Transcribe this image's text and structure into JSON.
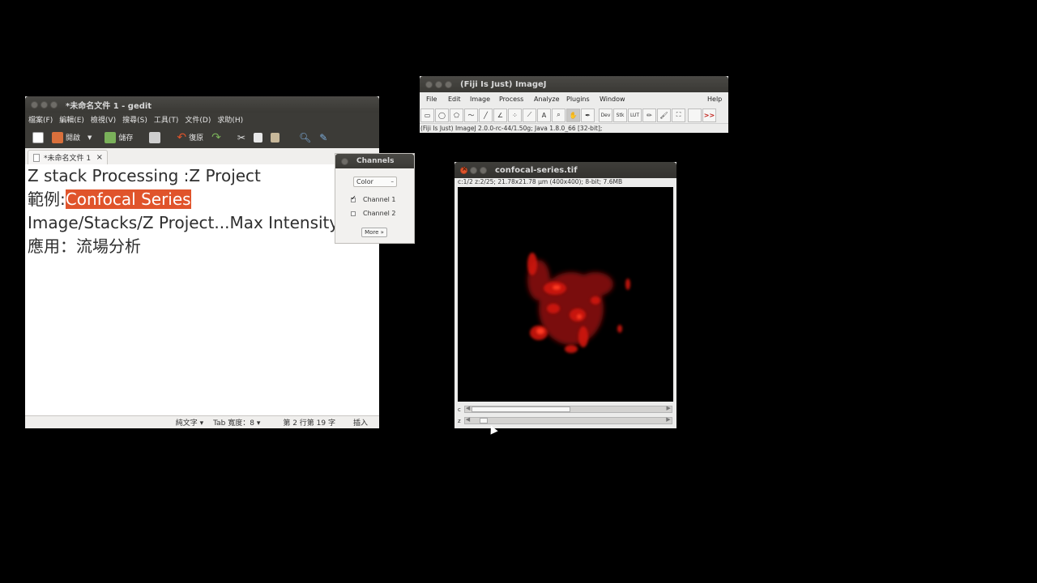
{
  "gedit": {
    "title": "*未命名文件 1 - gedit",
    "menu": [
      "檔案(F)",
      "編輯(E)",
      "檢視(V)",
      "搜尋(S)",
      "工具(T)",
      "文件(D)",
      "求助(H)"
    ],
    "toolbar": {
      "open": "開啟",
      "save": "儲存",
      "undo": "復原"
    },
    "tab_label": "*未命名文件 1",
    "tab_close": "×",
    "lines": {
      "l1": "Z stack Processing :Z Project",
      "l2_prefix": "範例:",
      "l2_selected": "Confocal Series",
      "l3": "Image/Stacks/Z Project...Max Intensity",
      "l4": "應用：流場分析"
    },
    "status": {
      "lang": "純文字 ▾",
      "tab_width": "Tab 寬度：8 ▾",
      "position": "第 2 行第 19 字",
      "mode": "插入"
    }
  },
  "channels": {
    "title": "Channels",
    "mode": "Color",
    "channel1": "Channel 1",
    "channel1_checked": true,
    "channel2": "Channel 2",
    "channel2_checked": false,
    "more": "More »"
  },
  "imagej": {
    "title": "(Fiji Is Just) ImageJ",
    "menu": [
      "File",
      "Edit",
      "Image",
      "Process",
      "Analyze",
      "Plugins",
      "Window",
      "Help"
    ],
    "tools": {
      "dev": "Dev",
      "stk": "Stk",
      "lut": "LUT",
      "more": ">>",
      "text": "A"
    },
    "status": "(Fiji Is Just) ImageJ 2.0.0-rc-44/1.50g; Java 1.8.0_66 [32-bit];"
  },
  "confocal": {
    "title": "confocal-series.tif",
    "info": "c:1/2 z:2/25; 21.78x21.78 µm (400x400); 8-bit; 7.6MB",
    "c_label": "c",
    "z_label": "z",
    "channel_position": 0.5,
    "z_position": 0.04
  },
  "colors": {
    "accent": "#e0542b",
    "titlebar": "#3c3b37"
  }
}
